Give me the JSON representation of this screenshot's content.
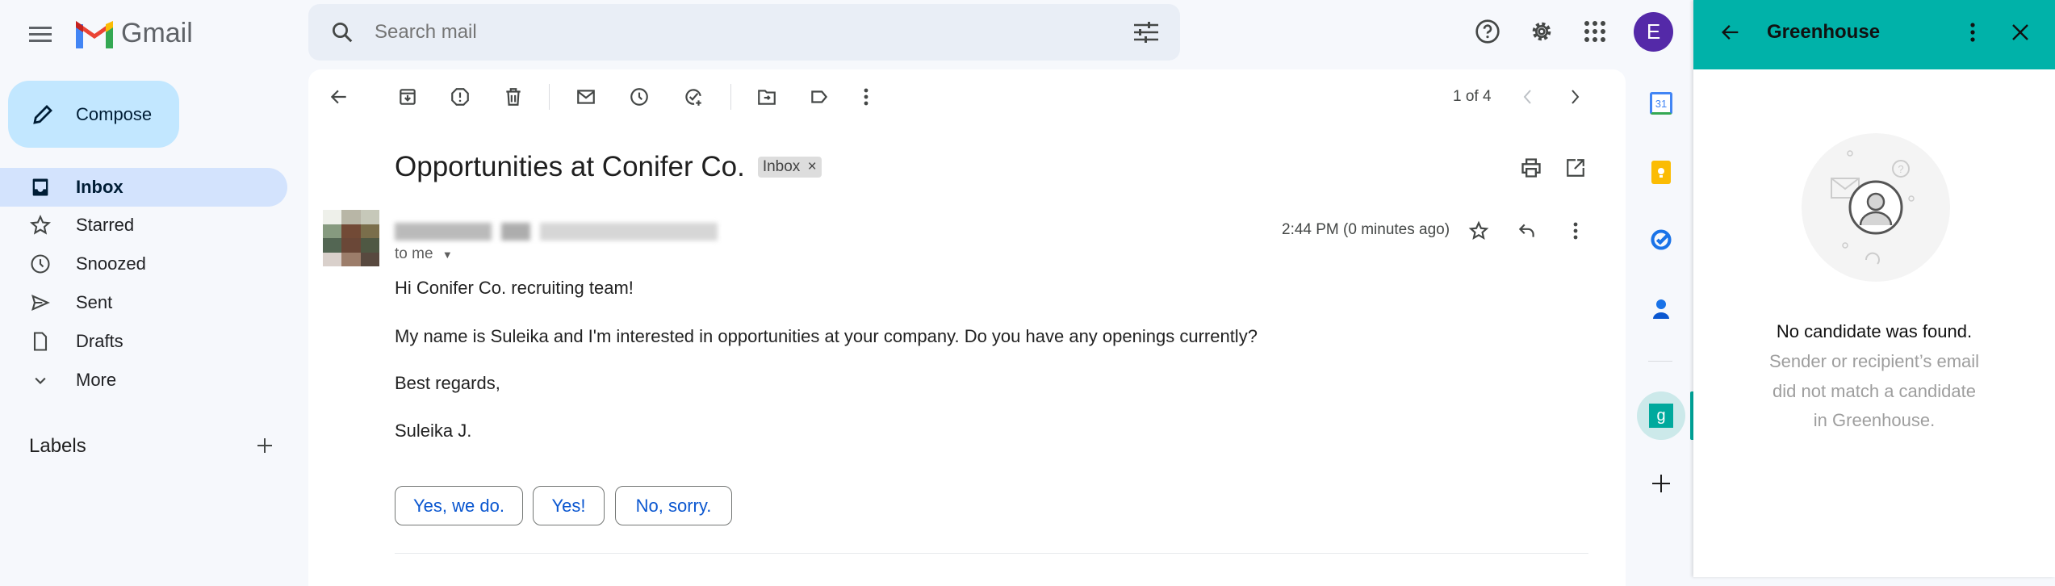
{
  "app": {
    "name": "Gmail"
  },
  "search": {
    "placeholder": "Search mail"
  },
  "account": {
    "initial": "E",
    "color": "#5429a8"
  },
  "compose": {
    "label": "Compose"
  },
  "sidebar": {
    "items": [
      {
        "label": "Inbox",
        "icon": "inbox-icon",
        "active": true
      },
      {
        "label": "Starred",
        "icon": "star-icon"
      },
      {
        "label": "Snoozed",
        "icon": "clock-icon"
      },
      {
        "label": "Sent",
        "icon": "send-icon"
      },
      {
        "label": "Drafts",
        "icon": "draft-icon"
      },
      {
        "label": "More",
        "icon": "chevron-down-icon"
      }
    ],
    "labels_heading": "Labels"
  },
  "toolbar": {
    "pagination": "1 of 4"
  },
  "email": {
    "subject": "Opportunities at Conifer Co.",
    "label_chip": "Inbox",
    "label_chip_close": "×",
    "recipient": "to me",
    "time": "2:44 PM (0 minutes ago)",
    "body": [
      "Hi Conifer Co. recruiting team!",
      "My name is Suleika and I'm interested in opportunities at your company. Do you have any openings currently?",
      "Best regards,",
      "Suleika J."
    ],
    "smart_replies": [
      "Yes, we do.",
      "Yes!",
      "No, sorry."
    ]
  },
  "addons": {
    "calendar_day": "31"
  },
  "greenhouse": {
    "title": "Greenhouse",
    "accent": "#00b2a9",
    "heading": "No candidate was found.",
    "message": [
      "Sender or recipient’s email",
      "did not match a candidate",
      "in Greenhouse."
    ]
  }
}
